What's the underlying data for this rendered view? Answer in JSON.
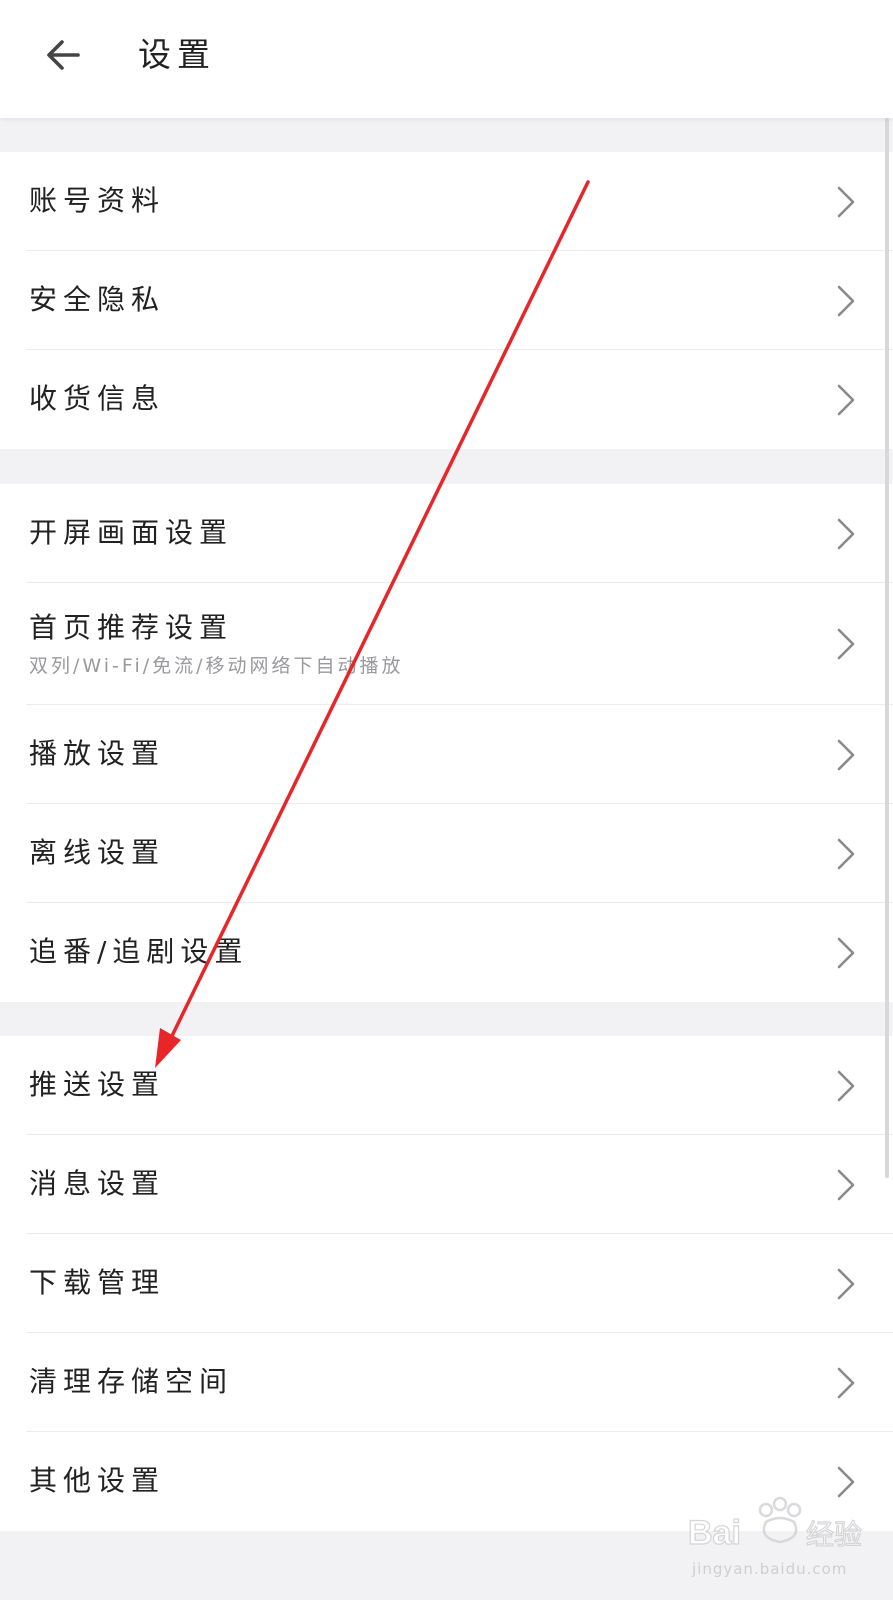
{
  "header": {
    "title": "设置",
    "back_icon": "arrow-left-icon"
  },
  "sections": [
    {
      "items": [
        {
          "label": "账号资料"
        },
        {
          "label": "安全隐私"
        },
        {
          "label": "收货信息"
        }
      ]
    },
    {
      "items": [
        {
          "label": "开屏画面设置"
        },
        {
          "label": "首页推荐设置",
          "sublabel": "双列/Wi-Fi/免流/移动网络下自动播放"
        },
        {
          "label": "播放设置"
        },
        {
          "label": "离线设置"
        },
        {
          "label": "追番/追剧设置"
        }
      ]
    },
    {
      "items": [
        {
          "label": "推送设置"
        },
        {
          "label": "消息设置"
        },
        {
          "label": "下载管理"
        },
        {
          "label": "清理存储空间"
        },
        {
          "label": "其他设置"
        }
      ]
    }
  ],
  "annotation": {
    "color": "#e8262a",
    "icon": "red-arrow-annotation"
  },
  "watermark": {
    "brand": "Baidu经验",
    "url": "jingyan.baidu.com"
  },
  "colors": {
    "background": "#f2f2f4",
    "surface": "#ffffff",
    "text": "#222222",
    "subtext": "#9a9a9e",
    "chevron": "#8a8a8e"
  }
}
